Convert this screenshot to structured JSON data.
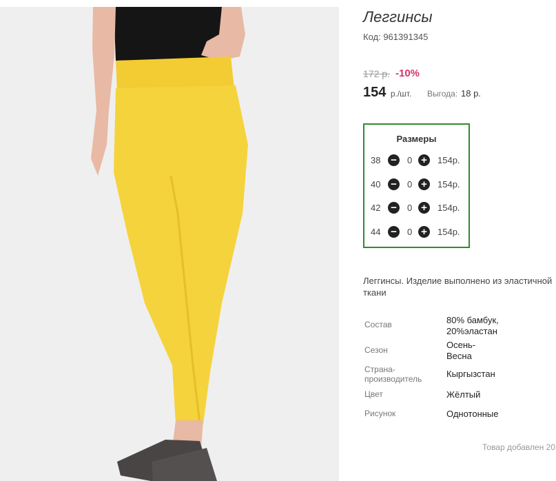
{
  "product": {
    "title": "Леггинсы",
    "code": "Код: 961391345",
    "old_price": "172 р.",
    "discount": "-10%",
    "price": "154",
    "unit": "р./шт.",
    "savings_label": "Выгода:",
    "savings_value": "18 р.",
    "image_alt": "yellow-leggings-photo"
  },
  "sizes": {
    "title": "Размеры",
    "items": [
      {
        "size": "38",
        "qty": "0",
        "price": "154р."
      },
      {
        "size": "40",
        "qty": "0",
        "price": "154р."
      },
      {
        "size": "42",
        "qty": "0",
        "price": "154р."
      },
      {
        "size": "44",
        "qty": "0",
        "price": "154р."
      }
    ],
    "minus_symbol": "−",
    "plus_symbol": "+"
  },
  "description": "Леггинсы. Изделие выполнено из эластичной ткани",
  "attributes": [
    {
      "label": "Состав",
      "value": "80% бамбук, 20%эластан"
    },
    {
      "label": "Сезон",
      "value": "Осень-Весна"
    },
    {
      "label": "Страна-производитель",
      "value": "Кыргызстан"
    },
    {
      "label": "Цвет",
      "value": "Жёлтый"
    },
    {
      "label": "Рисунок",
      "value": "Однотонные"
    }
  ],
  "added_text": "Товар добавлен 20",
  "colors": {
    "accent_border": "#2e8b2e",
    "discount": "#d6336c",
    "leggings": "#f5d33c"
  }
}
